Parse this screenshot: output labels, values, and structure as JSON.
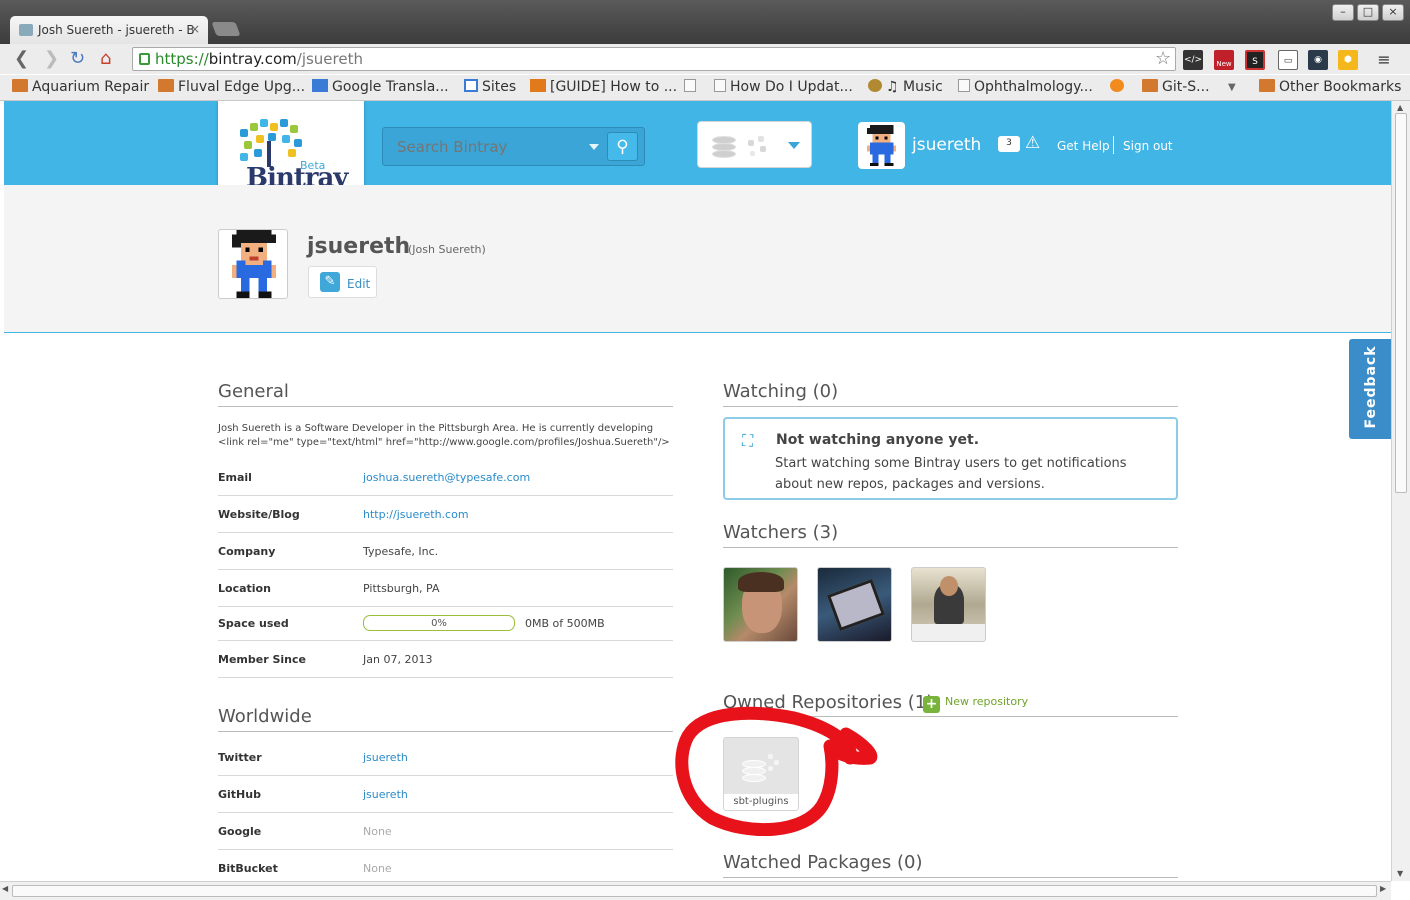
{
  "browser": {
    "tab_title": "Josh Suereth - jsuereth - B",
    "url_scheme": "https://",
    "url_host": "bintray.com",
    "url_path": "/jsuereth",
    "bookmarks": [
      {
        "label": "Aquarium Repair",
        "icon": "folder"
      },
      {
        "label": "Fluval Edge Upg...",
        "icon": "folder"
      },
      {
        "label": "Google Transla...",
        "icon": "translate"
      },
      {
        "label": "Sites",
        "icon": "sites"
      },
      {
        "label": "[GUIDE] How to ...",
        "icon": "xda"
      },
      {
        "label": "",
        "icon": "page"
      },
      {
        "label": "How Do I Updat...",
        "icon": "page"
      },
      {
        "label": "♫ Music",
        "icon": "music"
      },
      {
        "label": "Ophthalmology...",
        "icon": "page"
      },
      {
        "label": "",
        "icon": "bitcoin"
      },
      {
        "label": "Git-S...",
        "icon": "folder"
      },
      {
        "label": "Other Bookmarks",
        "icon": "folder"
      }
    ],
    "ext_new_badge": "New"
  },
  "header": {
    "logo_text": "Bintray",
    "logo_beta": "Beta",
    "search_placeholder": "Search Bintray",
    "username": "jsuereth",
    "message_count": "3",
    "help": "Get Help",
    "signout": "Sign out"
  },
  "profile": {
    "username": "jsuereth",
    "fullname": "(Josh Suereth)",
    "edit": "Edit"
  },
  "general": {
    "title": "General",
    "bio": "Josh Suereth is a Software Developer in the Pittsburgh Area. He is currently developing <link rel=\"me\" type=\"text/html\" href=\"http://www.google.com/profiles/Joshua.Suereth\"/>",
    "rows": [
      {
        "label": "Email",
        "value": "joshua.suereth@typesafe.com"
      },
      {
        "label": "Website/Blog",
        "value": "http://jsuereth.com"
      },
      {
        "label": "Company",
        "value": "Typesafe, Inc."
      },
      {
        "label": "Location",
        "value": "Pittsburgh, PA"
      },
      {
        "label": "Space used",
        "value": "0MB of 500MB"
      },
      {
        "label": "Member Since",
        "value": "Jan 07, 2013"
      }
    ],
    "space_percent_label": "0%",
    "space_fraction": 0
  },
  "worldwide": {
    "title": "Worldwide",
    "rows": [
      {
        "label": "Twitter",
        "value": "jsuereth"
      },
      {
        "label": "GitHub",
        "value": "jsuereth"
      },
      {
        "label": "Google",
        "value": "None"
      },
      {
        "label": "BitBucket",
        "value": "None"
      }
    ]
  },
  "watching": {
    "title": "Watching (0)",
    "empty_title": "Not watching anyone yet.",
    "empty_text": "Start watching some Bintray users to get notifications about new repos, packages and versions."
  },
  "watchers": {
    "title": "Watchers (3)"
  },
  "owned": {
    "title": "Owned Repositories (1)",
    "new_repo": "New repository",
    "repo_name": "sbt-plugins"
  },
  "watched_packages": {
    "title": "Watched Packages (0)"
  },
  "feedback": "Feedback",
  "colors": {
    "header_blue": "#40b5e6",
    "annotation_red": "#e8121a",
    "link_blue": "#2a8bc8"
  }
}
